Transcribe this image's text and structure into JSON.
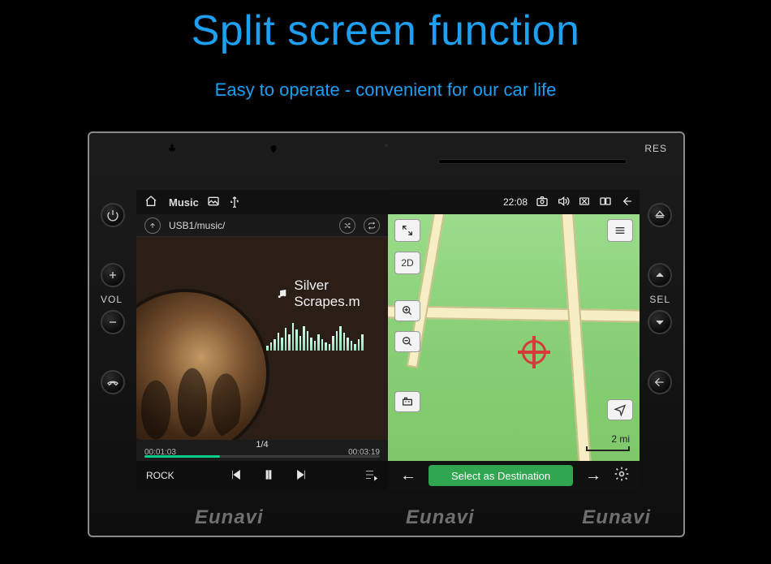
{
  "promo": {
    "title": "Split screen function",
    "subtitle": "Easy to operate - convenient for our car life",
    "brand": "Eunavi"
  },
  "bezel": {
    "left_label": "VOL",
    "right_label_sel": "SEL",
    "right_label_res": "RES"
  },
  "status": {
    "clock": "22:08"
  },
  "music": {
    "app_label": "Music",
    "crumb": "USB1/music/",
    "track_title": "Silver Scrapes.m",
    "elapsed": "00:01:03",
    "total": "00:03:19",
    "counter": "1/4",
    "eq_label": "ROCK",
    "progress_pct": 32
  },
  "map": {
    "view2d_label": "2D",
    "scale_label": "2 mi",
    "dest_button": "Select as Destination"
  },
  "eq_bars": [
    6,
    10,
    14,
    22,
    16,
    28,
    20,
    34,
    26,
    18,
    30,
    24,
    16,
    12,
    20,
    14,
    10,
    8,
    18,
    24,
    30,
    22,
    16,
    12,
    8,
    14,
    20
  ]
}
